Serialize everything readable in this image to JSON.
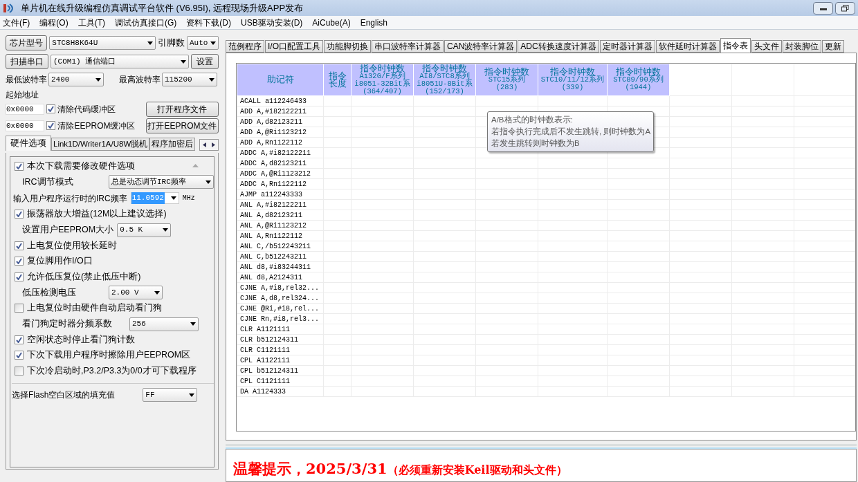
{
  "window": {
    "title": "单片机在线升级编程仿真调试平台软件 (V6.95I), 远程现场升级APP发布"
  },
  "menu": [
    "文件(F)",
    "编程(O)",
    "工具(T)",
    "调试仿真接口(G)",
    "资料下载(D)",
    "USB驱动安装(D)",
    "AiCube(A)",
    "English"
  ],
  "chip": {
    "button": "芯片型号",
    "value": "STC8H8K64U",
    "pins_label": "引脚数",
    "pins": "Auto"
  },
  "port": {
    "button": "扫描串口",
    "value": "(COM1) 通信端口",
    "settings": "设置"
  },
  "baud": {
    "min_label": "最低波特率",
    "min": "2400",
    "max_label": "最高波特率",
    "max": "115200"
  },
  "start_address": {
    "label": "起始地址",
    "rows": [
      {
        "value": "0x0000",
        "checkbox": "清除代码缓冲区",
        "checked": true,
        "button": "打开程序文件"
      },
      {
        "value": "0x0000",
        "checkbox": "清除EEPROM缓冲区",
        "checked": true,
        "button": "打开EEPROM文件"
      }
    ]
  },
  "left_tabs": [
    {
      "label": "硬件选项",
      "selected": true
    },
    {
      "label": "Link1D/Writer1A/U8W脱机",
      "selected": false
    },
    {
      "label": "程序加密后",
      "selected": false
    }
  ],
  "hw_options": [
    {
      "kind": "check",
      "label": "本次下载需要修改硬件选项",
      "checked": true
    },
    {
      "kind": "select",
      "label": "IRC调节模式",
      "value": "总是动态调节IRC频率"
    },
    {
      "kind": "input",
      "label": "输入用户程序运行时的IRC频率",
      "value": "11.0592",
      "unit": "MHz"
    },
    {
      "kind": "check",
      "label": "振荡器放大增益(12M以上建议选择)",
      "checked": true
    },
    {
      "kind": "select",
      "label": "设置用户EEPROM大小",
      "value": "0.5 K"
    },
    {
      "kind": "check",
      "label": "上电复位使用较长延时",
      "checked": true
    },
    {
      "kind": "check",
      "label": "复位脚用作I/O口",
      "checked": true
    },
    {
      "kind": "check",
      "label": "允许低压复位(禁止低压中断)",
      "checked": true
    },
    {
      "kind": "select",
      "label": "低压检测电压",
      "value": "2.00 V"
    },
    {
      "kind": "check",
      "label": "上电复位时由硬件自动启动看门狗",
      "checked": false
    },
    {
      "kind": "select",
      "label": "看门狗定时器分频系数",
      "value": "256"
    },
    {
      "kind": "check",
      "label": "空闲状态时停止看门狗计数",
      "checked": true
    },
    {
      "kind": "check",
      "label": "下次下载用户程序时擦除用户EEPROM区",
      "checked": true
    },
    {
      "kind": "check",
      "label": "下次冷启动时,P3.2/P3.3为0/0才可下载程序",
      "checked": false
    },
    {
      "kind": "fill",
      "label": "选择Flash空白区域的填充值",
      "value": "FF"
    }
  ],
  "tabs": [
    {
      "label": "范例程序",
      "selected": false
    },
    {
      "label": "I/O口配置工具",
      "selected": false
    },
    {
      "label": "功能脚切换",
      "selected": false
    },
    {
      "label": "串口波特率计算器",
      "selected": false
    },
    {
      "label": "CAN波特率计算器",
      "selected": false
    },
    {
      "label": "ADC转换速度计算器",
      "selected": false
    },
    {
      "label": "定时器计算器",
      "selected": false
    },
    {
      "label": "软件延时计算器",
      "selected": false
    },
    {
      "label": "指令表",
      "selected": true
    },
    {
      "label": "头文件",
      "selected": false
    },
    {
      "label": "封装脚位",
      "selected": false
    },
    {
      "label": "更新",
      "selected": false
    }
  ],
  "table": {
    "columns": [
      [
        "助记符"
      ],
      [
        "指令",
        "长度"
      ],
      [
        "指令时钟数",
        "Ai32G/F系列",
        "i8051-32Bit系",
        "(364/407)"
      ],
      [
        "指令时钟数",
        "AI8/STC8系列",
        "i8051U-8Bit系",
        "(152/173)"
      ],
      [
        "指令时钟数",
        "STC15系列",
        "(283)"
      ],
      [
        "指令时钟数",
        "STC10/11/12系列",
        "(339)"
      ],
      [
        "指令时钟数",
        "STC89/90系列",
        "(1944)"
      ]
    ],
    "rows": [
      "ACALL a112246433",
      "ADD A,#i82122211",
      "ADD A,d82123211",
      "ADD A,@Ri1123212",
      "ADD A,Rn1122112",
      "ADDC A,#i82122211",
      "ADDC A,d82123211",
      "ADDC A,@Ri1123212",
      "ADDC A,Rn1122112",
      "AJMP a112243333",
      "ANL A,#i82122211",
      "ANL A,d82123211",
      "ANL A,@Ri1123212",
      "ANL A,Rn1122112",
      "ANL C,/b512243211",
      "ANL C,b512243211",
      "ANL d8,#i83244311",
      "ANL d8,A2124311",
      "CJNE A,#i8,rel32...",
      "CJNE A,d8,rel324...",
      "CJNE @Ri,#i8,rel...",
      "CJNE Rn,#i8,rel3...",
      "CLR A1121111",
      "CLR b512124311",
      "CLR C1121111",
      "CPL A1122111",
      "CPL b512124311",
      "CPL C1121111",
      "DA A1124333"
    ]
  },
  "tooltip": [
    "A/B格式的时钟数表示:",
    "若指令执行完成后不发生跳转, 则时钟数为A",
    "若发生跳转则时钟数为B"
  ],
  "notice": {
    "main": "温馨提示，2025/3/31",
    "note": "（必须重新安装Keil驱动和头文件）"
  }
}
